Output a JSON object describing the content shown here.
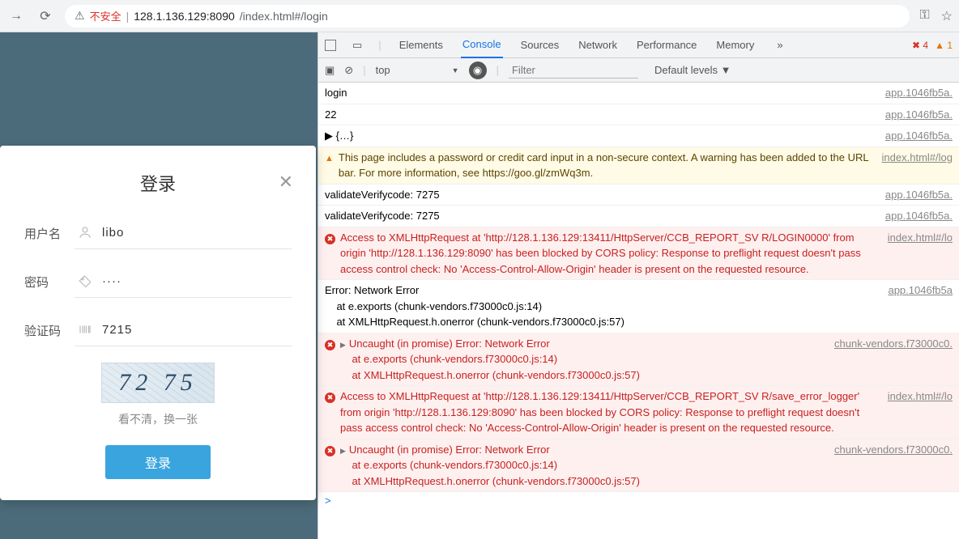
{
  "chrome": {
    "security_text": "不安全",
    "url_host": "128.1.136.129:8090",
    "url_path": "/index.html#/login"
  },
  "login": {
    "title": "登录",
    "username_label": "用户名",
    "username_value": "libo",
    "password_label": "密码",
    "password_value": "····",
    "captcha_label": "验证码",
    "captcha_value": "7215",
    "captcha_image_text": "72 75",
    "refresh_text": "看不清，换一张",
    "submit_label": "登录"
  },
  "devtools": {
    "tabs": [
      "Elements",
      "Console",
      "Sources",
      "Network",
      "Performance",
      "Memory"
    ],
    "active_tab": "Console",
    "error_count": "4",
    "warn_count": "1",
    "context": "top",
    "filter_placeholder": "Filter",
    "levels": "Default levels ▼"
  },
  "console": [
    {
      "type": "log",
      "msg": "login",
      "src": "app.1046fb5a."
    },
    {
      "type": "log",
      "msg": "22",
      "src": "app.1046fb5a."
    },
    {
      "type": "log",
      "msg": "▶ {…}",
      "src": "app.1046fb5a."
    },
    {
      "type": "warn",
      "msg": "This page includes a password or credit card input in a non-secure context. A warning has been added to the URL bar. For more information, see https://goo.gl/zmWq3m.",
      "src": "index.html#/log"
    },
    {
      "type": "log",
      "msg": "validateVerifycode: 7275",
      "src": "app.1046fb5a."
    },
    {
      "type": "log",
      "msg": "validateVerifycode: 7275",
      "src": "app.1046fb5a."
    },
    {
      "type": "error",
      "msg": "Access to XMLHttpRequest at 'http://128.1.136.129:13411/HttpServer/CCB_REPORT_SV R/LOGIN0000' from origin 'http://128.1.136.129:8090' has been blocked by CORS policy: Response to preflight request doesn't pass access control check: No 'Access-Control-Allow-Origin' header is present on the requested resource.",
      "src": "index.html#/lo"
    },
    {
      "type": "log",
      "msg": "Error: Network Error\n    at e.exports (chunk-vendors.f73000c0.js:14)\n    at XMLHttpRequest.h.onerror (chunk-vendors.f73000c0.js:57)",
      "src": "app.1046fb5a"
    },
    {
      "type": "error",
      "arrow": true,
      "msg": "Uncaught (in promise) Error: Network Error\n    at e.exports (chunk-vendors.f73000c0.js:14)\n    at XMLHttpRequest.h.onerror (chunk-vendors.f73000c0.js:57)",
      "src": "chunk-vendors.f73000c0."
    },
    {
      "type": "error",
      "msg": "Access to XMLHttpRequest at 'http://128.1.136.129:13411/HttpServer/CCB_REPORT_SV R/save_error_logger' from origin 'http://128.1.136.129:8090' has been blocked by CORS policy: Response to preflight request doesn't pass access control check: No 'Access-Control-Allow-Origin' header is present on the requested resource.",
      "src": "index.html#/lo"
    },
    {
      "type": "error",
      "arrow": true,
      "msg": "Uncaught (in promise) Error: Network Error\n    at e.exports (chunk-vendors.f73000c0.js:14)\n    at XMLHttpRequest.h.onerror (chunk-vendors.f73000c0.js:57)",
      "src": "chunk-vendors.f73000c0."
    }
  ]
}
